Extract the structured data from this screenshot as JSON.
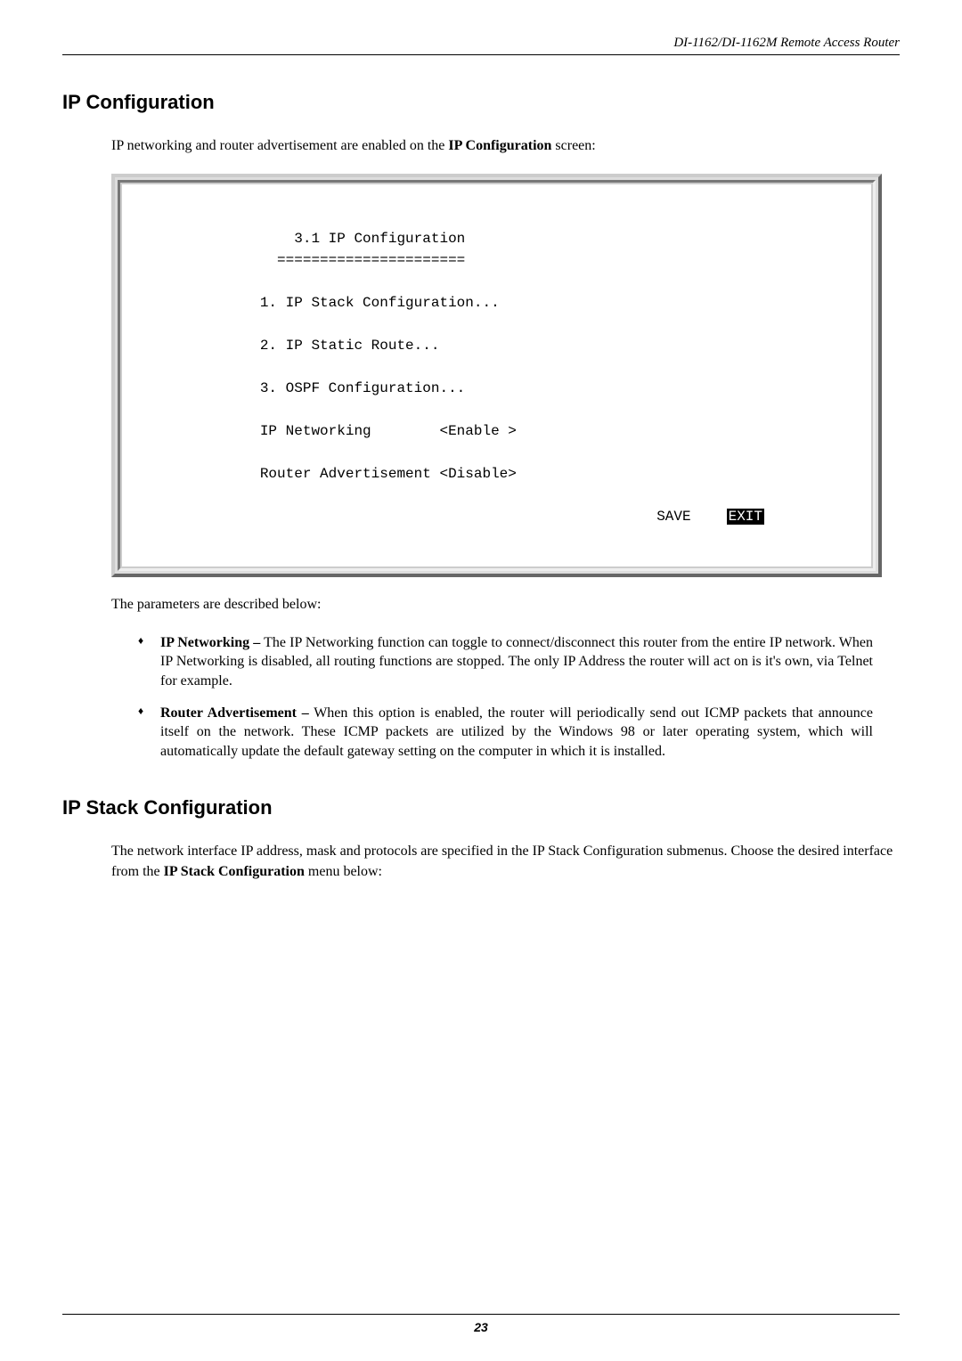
{
  "header": {
    "product_line": "DI-1162/DI-1162M Remote Access Router"
  },
  "section1": {
    "title": "IP Configuration",
    "intro_pre": "IP networking and router advertisement are enabled on the ",
    "intro_bold": "IP Configuration",
    "intro_post": " screen:"
  },
  "terminal": {
    "title": "3.1 IP Configuration",
    "divider": "======================",
    "item1": "1. IP Stack Configuration...",
    "item2": "2. IP Static Route...",
    "item3": "3. OSPF Configuration...",
    "ipnet_label": "IP Networking",
    "ipnet_value": "<Enable >",
    "radv_label": "Router Advertisement",
    "radv_value": "<Disable>",
    "save": "SAVE",
    "exit": "EXIT"
  },
  "params_intro": "The parameters are described below:",
  "bullets": {
    "b1_bold": "IP Networking –",
    "b1_text": " The IP Networking function can toggle to connect/disconnect this router from the entire IP network. When IP Networking is disabled, all routing functions are stopped. The only IP Address the router will act on is it's own, via Telnet for example.",
    "b2_bold": "Router Advertisement –",
    "b2_text": " When this option is enabled, the router will periodically send out ICMP packets that announce itself on the network. These ICMP packets are utilized by the Windows 98 or later operating system, which will automatically update the default gateway setting on the computer in which it is installed."
  },
  "section2": {
    "title": "IP Stack Configuration",
    "text_pre": "The network interface IP address, mask and protocols are specified in the IP Stack Configuration submenus. Choose the desired interface from the ",
    "text_bold": "IP Stack Configuration",
    "text_post": " menu below:"
  },
  "footer": {
    "pagenum": "23"
  }
}
